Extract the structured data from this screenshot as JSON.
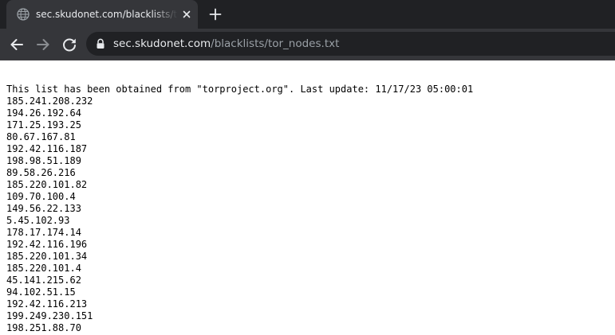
{
  "tab": {
    "title": "sec.skudonet.com/blacklists/tor_nodes.txt",
    "favicon": "globe-icon",
    "close": "close-icon"
  },
  "new_tab": "plus-icon",
  "toolbar": {
    "back": "back-arrow-icon",
    "forward": "forward-arrow-icon",
    "reload": "reload-icon"
  },
  "address_bar": {
    "lock": "lock-icon",
    "host": "sec.skudonet.com",
    "path": "/blacklists/tor_nodes.txt"
  },
  "document": {
    "header": "This list has been obtained from \"torproject.org\". Last update: 11/17/23 05:00:01",
    "ips": [
      "185.241.208.232",
      "194.26.192.64",
      "171.25.193.25",
      "80.67.167.81",
      "192.42.116.187",
      "198.98.51.189",
      "89.58.26.216",
      "185.220.101.82",
      "109.70.100.4",
      "149.56.22.133",
      "5.45.102.93",
      "178.17.174.14",
      "192.42.116.196",
      "185.220.101.34",
      "185.220.101.4",
      "45.141.215.62",
      "94.102.51.15",
      "192.42.116.213",
      "199.249.230.151",
      "198.251.88.70"
    ]
  },
  "colors": {
    "tab_strip": "#202124",
    "active_tab": "#35363a",
    "omnibox": "#202124",
    "text_light": "#e8eaed",
    "text_dim": "#9aa0a6"
  }
}
